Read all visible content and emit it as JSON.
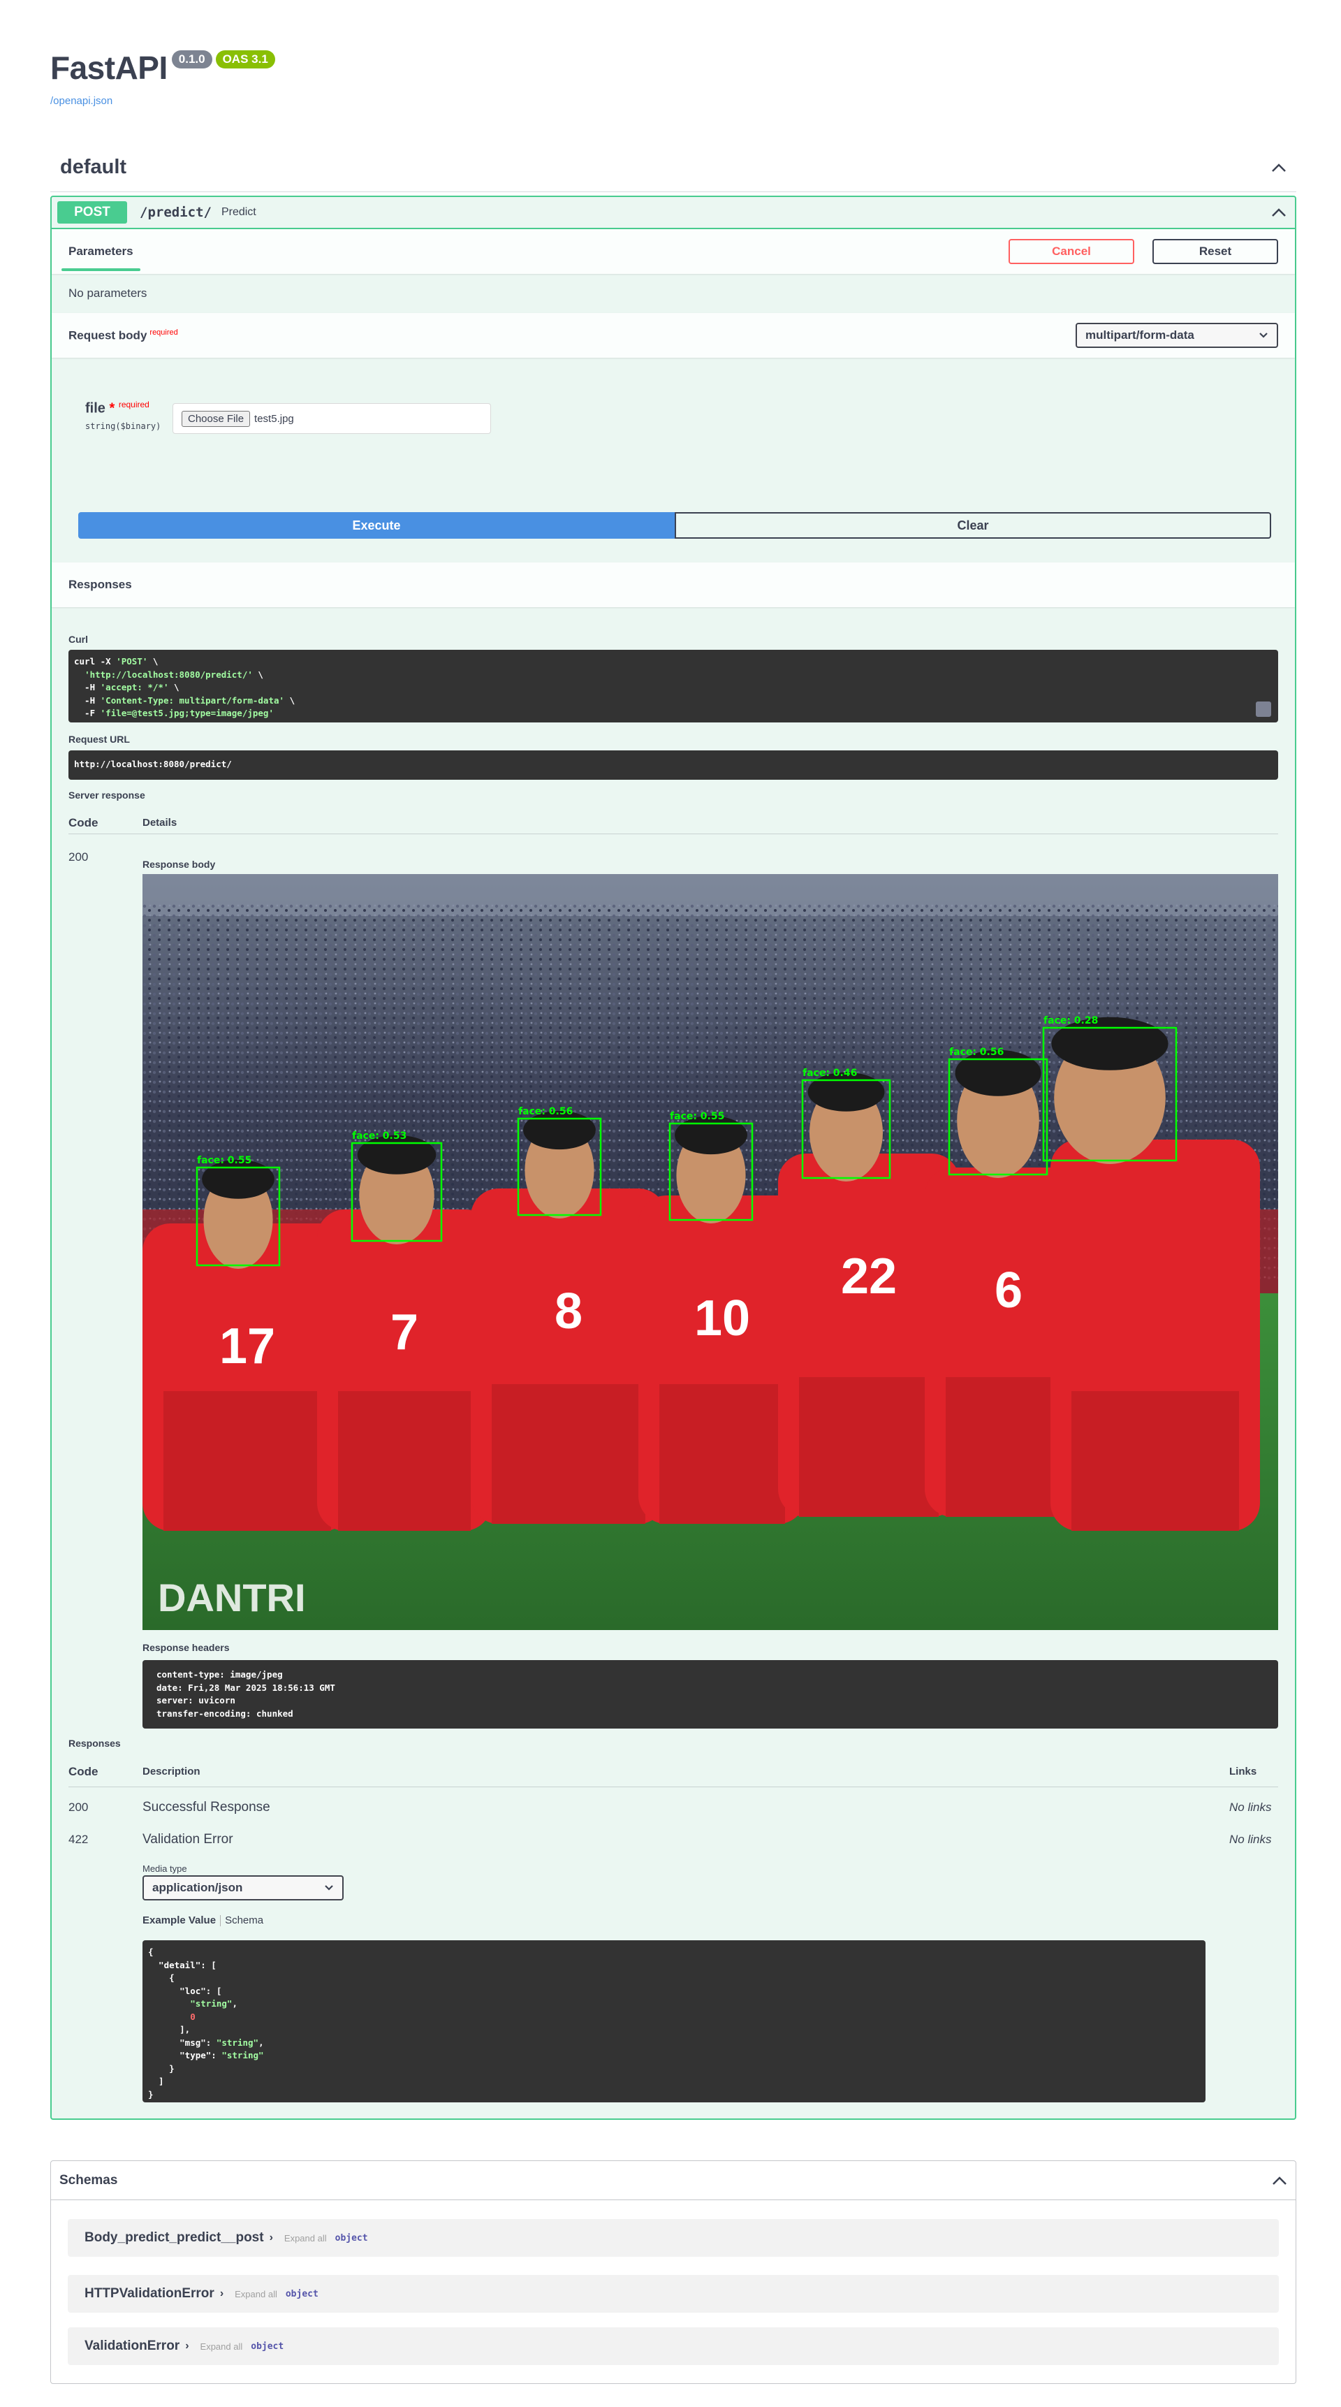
{
  "info": {
    "title": "FastAPI",
    "version_badge": "0.1.0",
    "oas_badge": "OAS 3.1",
    "openapi_link": "/openapi.json"
  },
  "tag": {
    "name": "default"
  },
  "operation": {
    "method": "POST",
    "path": "/predict/",
    "summary": "Predict",
    "tab_parameters": "Parameters",
    "cancel_label": "Cancel",
    "reset_label": "Reset",
    "no_params": "No parameters",
    "request_body_label": "Request body",
    "required_label": "required",
    "content_type": "multipart/form-data",
    "file_field": {
      "name": "file",
      "star": "*",
      "required": "required",
      "type": "string($binary)",
      "choose_label": "Choose File",
      "file_name": "test5.jpg"
    },
    "execute_label": "Execute",
    "clear_label": "Clear"
  },
  "responses_section": {
    "title": "Responses",
    "curl_label": "Curl",
    "curl_lines": [
      "curl -X 'POST' \\",
      "  'http://localhost:8080/predict/' \\",
      "  -H 'accept: */*' \\",
      "  -H 'Content-Type: multipart/form-data' \\",
      "  -F 'file=@test5.jpg;type=image/jpeg'"
    ],
    "request_url_label": "Request URL",
    "request_url": "http://localhost:8080/predict/",
    "server_response_label": "Server response",
    "col_code": "Code",
    "col_details": "Details",
    "status_code": "200",
    "response_body_label": "Response body",
    "response_image": {
      "watermark": "DANTRI",
      "detections": [
        {
          "label": "face: 0.55"
        },
        {
          "label": "face: 0.53"
        },
        {
          "label": "face: 0.56"
        },
        {
          "label": "face: 0.55"
        },
        {
          "label": "face: 0.46"
        },
        {
          "label": "face: 0.56"
        },
        {
          "label": "face: 0.28"
        }
      ],
      "jersey_numbers": [
        "17",
        "7",
        "8",
        "10",
        "22",
        "6"
      ]
    },
    "response_headers_label": "Response headers",
    "response_headers": [
      "content-type: image/jpeg",
      "date: Fri,28 Mar 2025 18:56:13 GMT",
      "server: uvicorn",
      "transfer-encoding: chunked"
    ]
  },
  "responses_doc": {
    "title": "Responses",
    "col_code": "Code",
    "col_description": "Description",
    "col_links": "Links",
    "rows": [
      {
        "code": "200",
        "description": "Successful Response",
        "links": "No links"
      },
      {
        "code": "422",
        "description": "Validation Error",
        "links": "No links"
      }
    ],
    "media_type_label": "Media type",
    "media_type": "application/json",
    "example_value_tab": "Example Value",
    "schema_tab": "Schema"
  },
  "schemas": {
    "title": "Schemas",
    "expand_all": "Expand all",
    "items": [
      {
        "name": "Body_predict_predict__post",
        "type": "object"
      },
      {
        "name": "HTTPValidationError",
        "type": "object"
      },
      {
        "name": "ValidationError",
        "type": "object"
      }
    ]
  },
  "colors": {
    "post_green": "#49cc90",
    "execute_blue": "#4990e2",
    "cancel_red": "#ff6060",
    "detection_box": "#00ff00",
    "jersey_red": "#e0232a"
  }
}
